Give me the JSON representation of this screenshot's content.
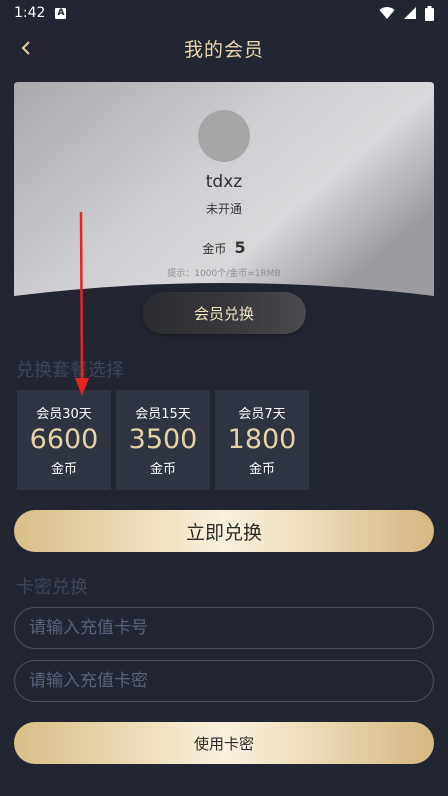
{
  "status_bar": {
    "time": "1:42",
    "notif_glyph": "A"
  },
  "header": {
    "title": "我的会员",
    "back_glyph": "‹"
  },
  "card": {
    "username": "tdxz",
    "member_status": "未开通",
    "coins_label": "金币",
    "coins_value": "5",
    "hint": "提示：1000个/金币=1RMB"
  },
  "redeem_member_label": "会员兑换",
  "plans_title": "兑换套餐选择",
  "plans": [
    {
      "name": "会员30天",
      "price": "6600",
      "unit": "金币"
    },
    {
      "name": "会员15天",
      "price": "3500",
      "unit": "金币"
    },
    {
      "name": "会员7天",
      "price": "1800",
      "unit": "金币"
    }
  ],
  "redeem_now_label": "立即兑换",
  "card_code_title": "卡密兑换",
  "card_number_placeholder": "请输入充值卡号",
  "card_password_placeholder": "请输入充值卡密",
  "use_card_label": "使用卡密",
  "colors": {
    "background": "#222633",
    "accent_gold": "#e6d2a6",
    "arrow": "#e3261f"
  }
}
